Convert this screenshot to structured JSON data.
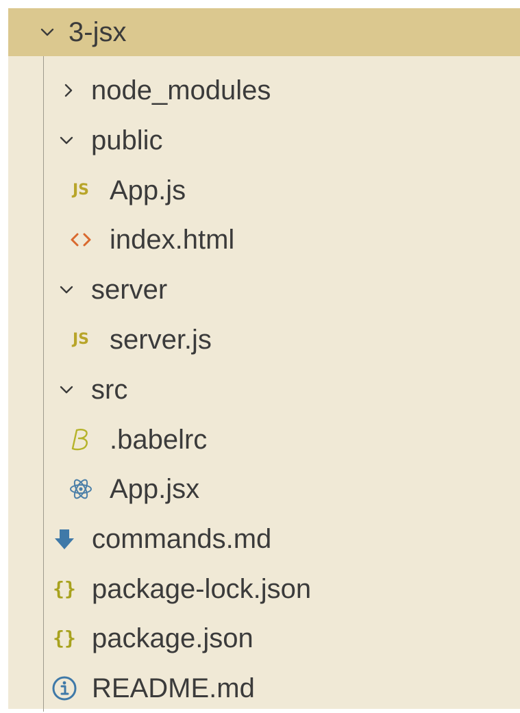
{
  "explorer": {
    "root": {
      "label": "3-jsx",
      "expanded": true
    },
    "items": [
      {
        "label": "node_modules",
        "type": "folder",
        "expanded": false
      },
      {
        "label": "public",
        "type": "folder",
        "expanded": true
      },
      {
        "label": "App.js",
        "type": "file",
        "icon": "js-file-icon",
        "icon_text": "JS"
      },
      {
        "label": "index.html",
        "type": "file",
        "icon": "html-file-icon"
      },
      {
        "label": "server",
        "type": "folder",
        "expanded": true
      },
      {
        "label": "server.js",
        "type": "file",
        "icon": "js-file-icon",
        "icon_text": "JS"
      },
      {
        "label": "src",
        "type": "folder",
        "expanded": true
      },
      {
        "label": ".babelrc",
        "type": "file",
        "icon": "babel-file-icon"
      },
      {
        "label": "App.jsx",
        "type": "file",
        "icon": "react-file-icon"
      },
      {
        "label": "commands.md",
        "type": "file",
        "icon": "download-arrow-icon"
      },
      {
        "label": "package-lock.json",
        "type": "file",
        "icon": "json-file-icon",
        "icon_text": "{}"
      },
      {
        "label": "package.json",
        "type": "file",
        "icon": "json-file-icon",
        "icon_text": "{}"
      },
      {
        "label": "README.md",
        "type": "file",
        "icon": "info-icon"
      }
    ]
  },
  "colors": {
    "panel_background": "#f0e9d6",
    "header_background": "#dbc88f",
    "js_icon": "#b8a52a",
    "html_icon": "#d9692e",
    "babel_icon": "#b5b329",
    "react_icon": "#4b7fa8",
    "markdown_icon": "#3f79a8",
    "json_icon": "#a8a21e",
    "info_icon": "#3f79a8"
  }
}
